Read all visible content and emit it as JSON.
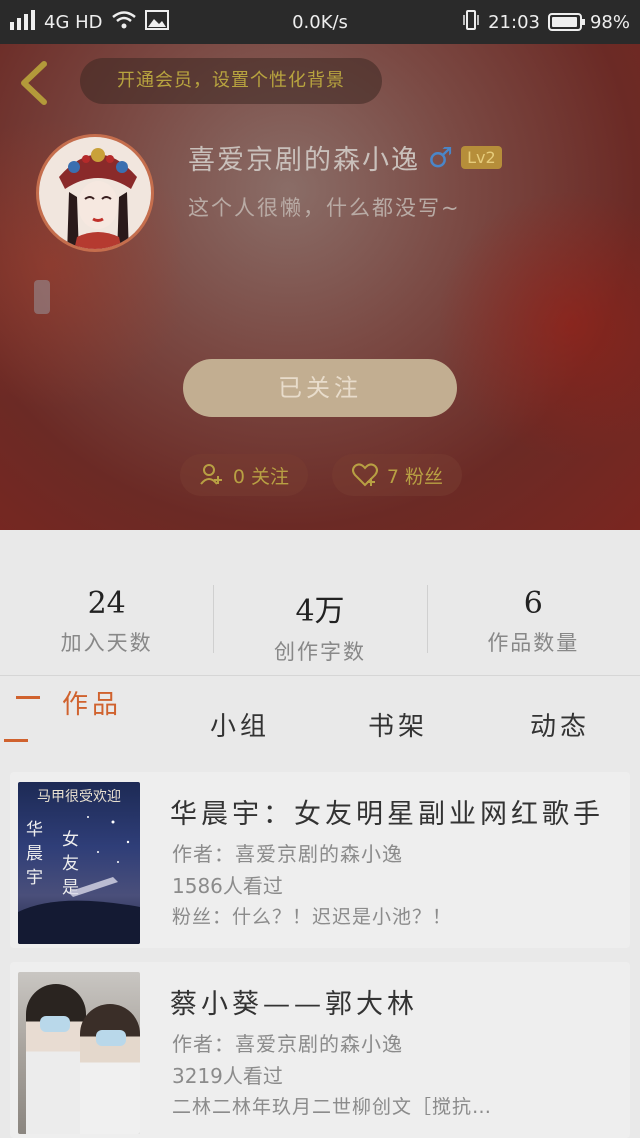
{
  "status_bar": {
    "signal": "4G HD",
    "speed": "0.0K/s",
    "time": "21:03",
    "battery_text": "98%",
    "battery_level": 0.98
  },
  "header": {
    "vip_banner": "开通会员，设置个性化背景"
  },
  "profile": {
    "username": "喜爱京剧的森小逸",
    "gender_symbol": "♂",
    "level": "Lv2",
    "bio": "这个人很懒，什么都没写~",
    "follow_button": "已关注",
    "following": "0 关注",
    "fans": "7 粉丝"
  },
  "stats": [
    {
      "value": "24",
      "label": "加入天数"
    },
    {
      "value": "4万",
      "label": "创作字数"
    },
    {
      "value": "6",
      "label": "作品数量"
    }
  ],
  "tabs": {
    "works": "作品",
    "group": "小组",
    "shelf": "书架",
    "feed": "动态"
  },
  "works": [
    {
      "title": "华晨宇：女友明星副业网红歌手",
      "author": "作者：喜爱京剧的森小逸",
      "views": "1586人看过",
      "desc": "粉丝：什么？！迟迟是小池？！",
      "cover_title": "马甲很受欢迎",
      "cover_side": "华晨宇",
      "cover_mid": "女友是明星"
    },
    {
      "title": "蔡小葵——郭大林",
      "author": "作者：喜爱京剧的森小逸",
      "views": "3219人看过",
      "desc": "二林二林年玖月二世柳创文［搅抗…"
    }
  ],
  "colors": {
    "accent": "#d0622e",
    "vip_text": "#b8a43f",
    "follow_button": "#c2ae91"
  }
}
